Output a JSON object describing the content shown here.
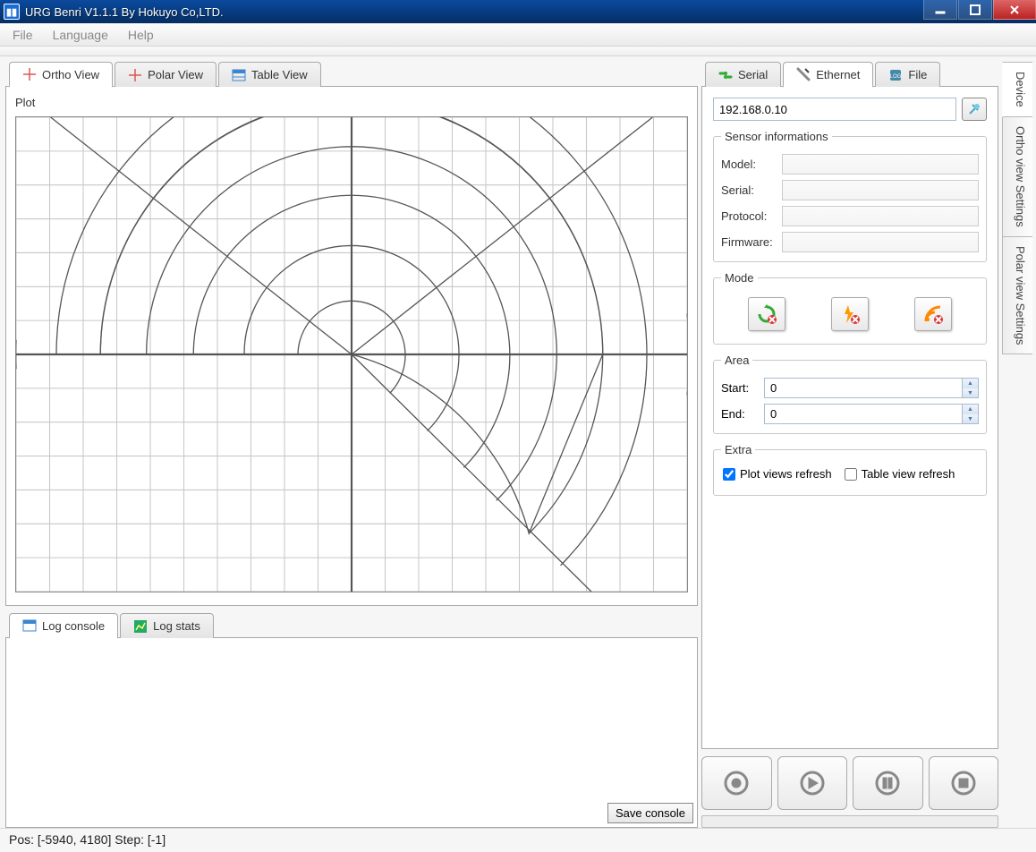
{
  "window": {
    "title": "URG Benri V1.1.1 By Hokuyo Co,LTD."
  },
  "menu": {
    "file": "File",
    "language": "Language",
    "help": "Help"
  },
  "view_tabs": {
    "ortho": "Ortho View",
    "polar": "Polar View",
    "table": "Table View"
  },
  "plot": {
    "label": "Plot"
  },
  "log_tabs": {
    "console": "Log console",
    "stats": "Log stats"
  },
  "log": {
    "save_btn": "Save console"
  },
  "conn_tabs": {
    "serial": "Serial",
    "ethernet": "Ethernet",
    "file": "File"
  },
  "ethernet": {
    "ip": "192.168.0.10"
  },
  "sensor_info": {
    "legend": "Sensor informations",
    "model_label": "Model:",
    "model_value": "",
    "serial_label": "Serial:",
    "serial_value": "",
    "protocol_label": "Protocol:",
    "protocol_value": "",
    "firmware_label": "Firmware:",
    "firmware_value": ""
  },
  "mode": {
    "legend": "Mode"
  },
  "area": {
    "legend": "Area",
    "start_label": "Start:",
    "start_value": "0",
    "end_label": "End:",
    "end_value": "0"
  },
  "extra": {
    "legend": "Extra",
    "plot_refresh": "Plot views refresh",
    "table_refresh": "Table view refresh",
    "plot_checked": true,
    "table_checked": false
  },
  "side_tabs": {
    "device": "Device",
    "ortho": "Ortho view Settings",
    "polar": "Polar view Settings"
  },
  "status": {
    "text": "Pos: [-5940, 4180] Step: [-1]"
  }
}
